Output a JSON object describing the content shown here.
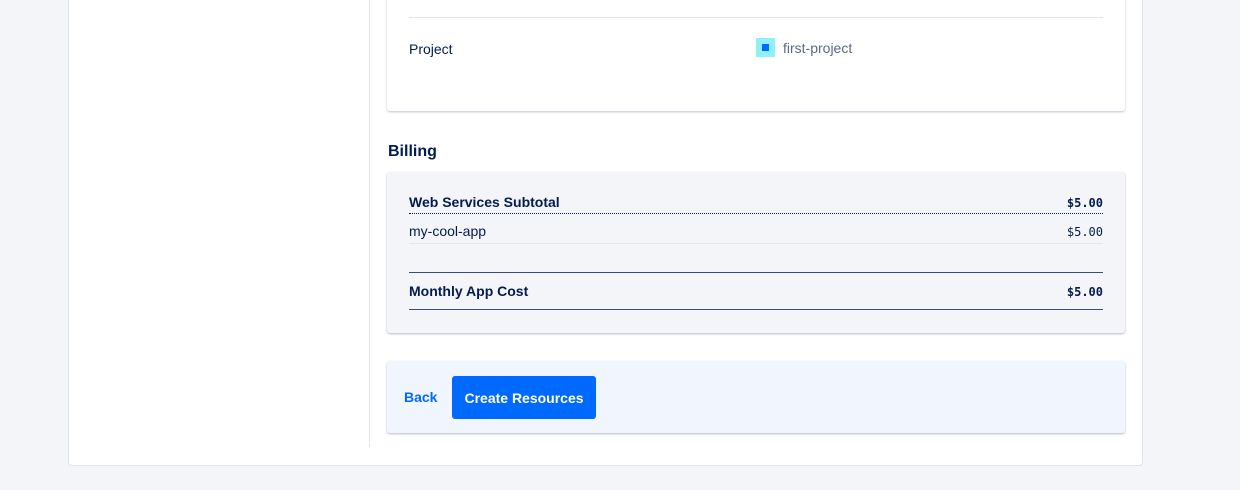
{
  "details": {
    "project_label": "Project",
    "project_name": "first-project",
    "project_color": "#8ff0f7"
  },
  "billing": {
    "heading": "Billing",
    "subtotal_label": "Web Services Subtotal",
    "subtotal_amount": "$5.00",
    "items": [
      {
        "name": "my-cool-app",
        "amount": "$5.00"
      }
    ],
    "total_label": "Monthly App Cost",
    "total_amount": "$5.00"
  },
  "actions": {
    "back_label": "Back",
    "create_label": "Create Resources",
    "accent_color": "#0069ff"
  }
}
